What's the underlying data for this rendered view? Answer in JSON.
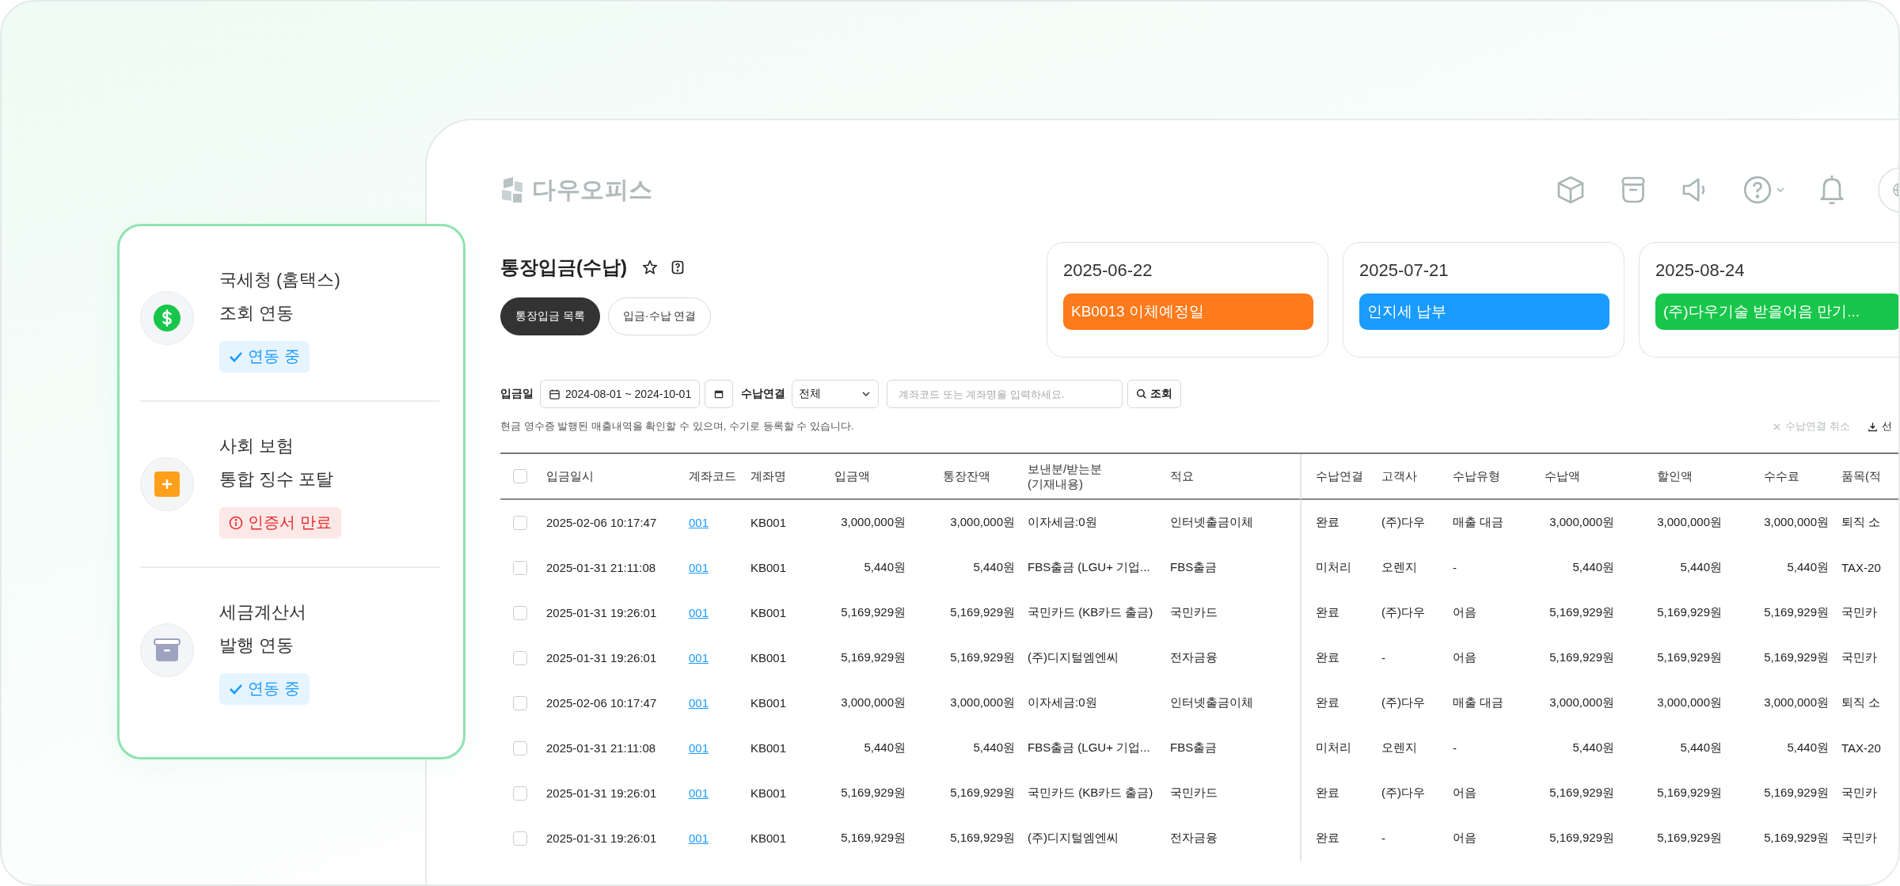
{
  "integrations": [
    {
      "title_lines": [
        "국세청 (홈택스)",
        "조회 연동"
      ],
      "badge": {
        "kind": "ok",
        "text": "연동 중"
      }
    },
    {
      "title_lines": [
        "사회 보험",
        "통합 징수 포탈"
      ],
      "badge": {
        "kind": "error",
        "text": "인증서 만료"
      }
    },
    {
      "title_lines": [
        "세금계산서",
        "발행 연동"
      ],
      "badge": {
        "kind": "ok",
        "text": "연동 중"
      }
    }
  ],
  "app": {
    "logo": "다우오피스",
    "page_title": "통장입금(수납)",
    "tabs": [
      {
        "label": "통장입금 목록",
        "selected": true
      },
      {
        "label": "입금·수납 연결",
        "selected": false
      }
    ],
    "events": [
      {
        "date": "2025-06-22",
        "label": "KB0013 이체예정일",
        "color": "#ff7a1a"
      },
      {
        "date": "2025-07-21",
        "label": "인지세 납부",
        "color": "#1a9bff"
      },
      {
        "date": "2025-08-24",
        "label": "(주)다우기술 받을어음 만기...",
        "color": "#17c64a"
      }
    ],
    "filters": {
      "date_label": "입금일",
      "date_range": "2024-08-01 ~ 2024-10-01",
      "link_label": "수납연결",
      "link_value": "전체",
      "search_placeholder": "계좌코드 또는 계좌명을 입력하세요.",
      "search_button": "조회"
    },
    "note": "현금 영수증 발행된 매출내역을 확인할 수 있으며, 수기로 등록할 수 있습니다.",
    "actions": [
      {
        "kind": "cancel",
        "label": "수납연결 취소",
        "disabled": true
      },
      {
        "kind": "download",
        "label": "선",
        "disabled": false
      }
    ],
    "table": {
      "all_checked": false,
      "columns": [
        {
          "label": "입금일시",
          "kind": "text"
        },
        {
          "label": "계좌코드",
          "kind": "link"
        },
        {
          "label": "계좌명",
          "kind": "text"
        },
        {
          "label": "입금액",
          "kind": "amount"
        },
        {
          "label": "통장잔액",
          "kind": "amount"
        },
        {
          "label": "보낸분/받는분",
          "sublabel": "(기재내용)",
          "kind": "text"
        },
        {
          "label": "적요",
          "kind": "text"
        },
        {
          "label": "수납연결",
          "kind": "text"
        },
        {
          "label": "고객사",
          "kind": "text"
        },
        {
          "label": "수납유형",
          "kind": "text"
        },
        {
          "label": "수납액",
          "kind": "amount"
        },
        {
          "label": "할인액",
          "kind": "amount"
        },
        {
          "label": "수수료",
          "kind": "amount"
        },
        {
          "label": "품목(적",
          "kind": "text"
        }
      ],
      "rows": [
        {
          "checked": false,
          "cells": [
            "2025-02-06 10:17:47",
            "001",
            "KB001",
            "3,000,000원",
            "3,000,000원",
            "이자세금:0원",
            "인터넷출금이체",
            "완료",
            "(주)다우",
            "매출 대금",
            "3,000,000원",
            "3,000,000원",
            "3,000,000원",
            "퇴직 소"
          ]
        },
        {
          "checked": false,
          "cells": [
            "2025-01-31 21:11:08",
            "001",
            "KB001",
            "5,440원",
            "5,440원",
            "FBS출금 (LGU+ 기업...",
            "FBS출금",
            "미처리",
            "오렌지",
            "-",
            "5,440원",
            "5,440원",
            "5,440원",
            "TAX-20"
          ]
        },
        {
          "checked": false,
          "cells": [
            "2025-01-31 19:26:01",
            "001",
            "KB001",
            "5,169,929원",
            "5,169,929원",
            "국민카드 (KB카드 출금)",
            "국민카드",
            "완료",
            "(주)다우",
            "어음",
            "5,169,929원",
            "5,169,929원",
            "5,169,929원",
            "국민카"
          ]
        },
        {
          "checked": false,
          "cells": [
            "2025-01-31 19:26:01",
            "001",
            "KB001",
            "5,169,929원",
            "5,169,929원",
            "(주)디지털엠엔씨",
            "전자금융",
            "완료",
            "-",
            "어음",
            "5,169,929원",
            "5,169,929원",
            "5,169,929원",
            "국민카"
          ]
        },
        {
          "checked": false,
          "cells": [
            "2025-02-06 10:17:47",
            "001",
            "KB001",
            "3,000,000원",
            "3,000,000원",
            "이자세금:0원",
            "인터넷출금이체",
            "완료",
            "(주)다우",
            "매출 대금",
            "3,000,000원",
            "3,000,000원",
            "3,000,000원",
            "퇴직 소"
          ]
        },
        {
          "checked": false,
          "cells": [
            "2025-01-31 21:11:08",
            "001",
            "KB001",
            "5,440원",
            "5,440원",
            "FBS출금 (LGU+ 기업...",
            "FBS출금",
            "미처리",
            "오렌지",
            "-",
            "5,440원",
            "5,440원",
            "5,440원",
            "TAX-20"
          ]
        },
        {
          "checked": false,
          "cells": [
            "2025-01-31 19:26:01",
            "001",
            "KB001",
            "5,169,929원",
            "5,169,929원",
            "국민카드 (KB카드 출금)",
            "국민카드",
            "완료",
            "(주)다우",
            "어음",
            "5,169,929원",
            "5,169,929원",
            "5,169,929원",
            "국민카"
          ]
        },
        {
          "checked": false,
          "cells": [
            "2025-01-31 19:26:01",
            "001",
            "KB001",
            "5,169,929원",
            "5,169,929원",
            "(주)디지털엠엔씨",
            "전자금융",
            "완료",
            "-",
            "어음",
            "5,169,929원",
            "5,169,929원",
            "5,169,929원",
            "국민카"
          ]
        }
      ]
    }
  }
}
